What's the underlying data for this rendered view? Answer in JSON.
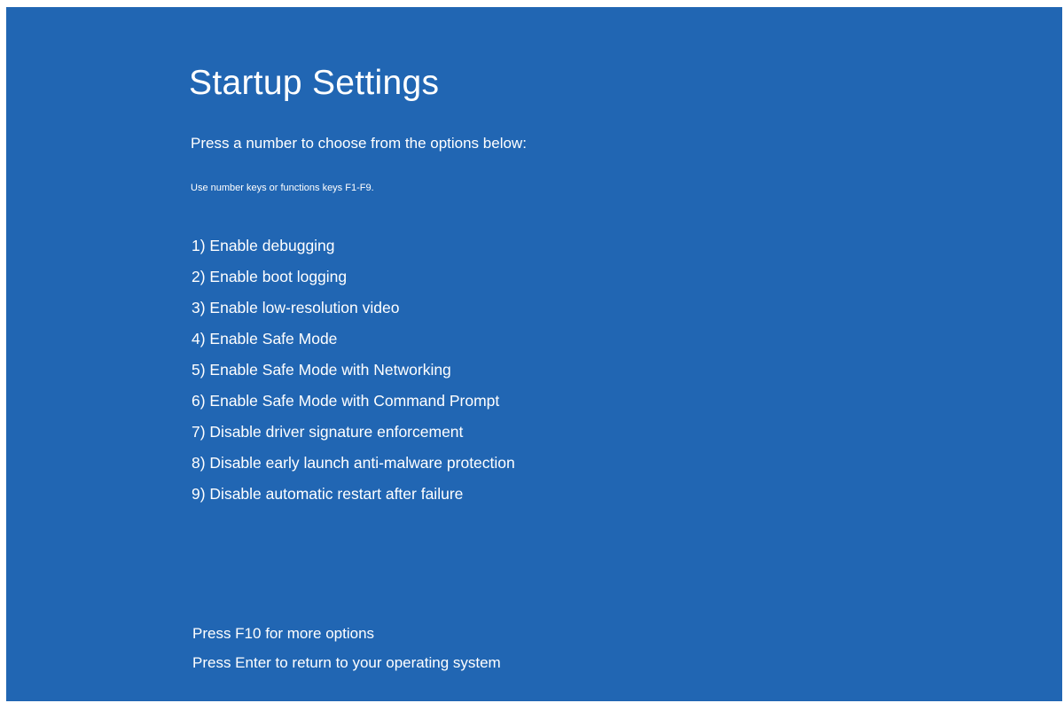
{
  "screen": {
    "title": "Startup Settings",
    "prompt": "Press a number to choose from the options below:",
    "hint": "Use number keys or functions keys F1-F9.",
    "background_color": "#2166b3",
    "text_color": "#ffffff"
  },
  "options": [
    "1) Enable debugging",
    "2) Enable boot logging",
    "3) Enable low-resolution video",
    "4) Enable Safe Mode",
    "5) Enable Safe Mode with Networking",
    "6) Enable Safe Mode with Command Prompt",
    "7) Disable driver signature enforcement",
    "8) Disable early launch anti-malware protection",
    "9) Disable automatic restart after failure"
  ],
  "footer": {
    "more_options": "Press F10 for more options",
    "return": "Press Enter to return to your operating system"
  }
}
